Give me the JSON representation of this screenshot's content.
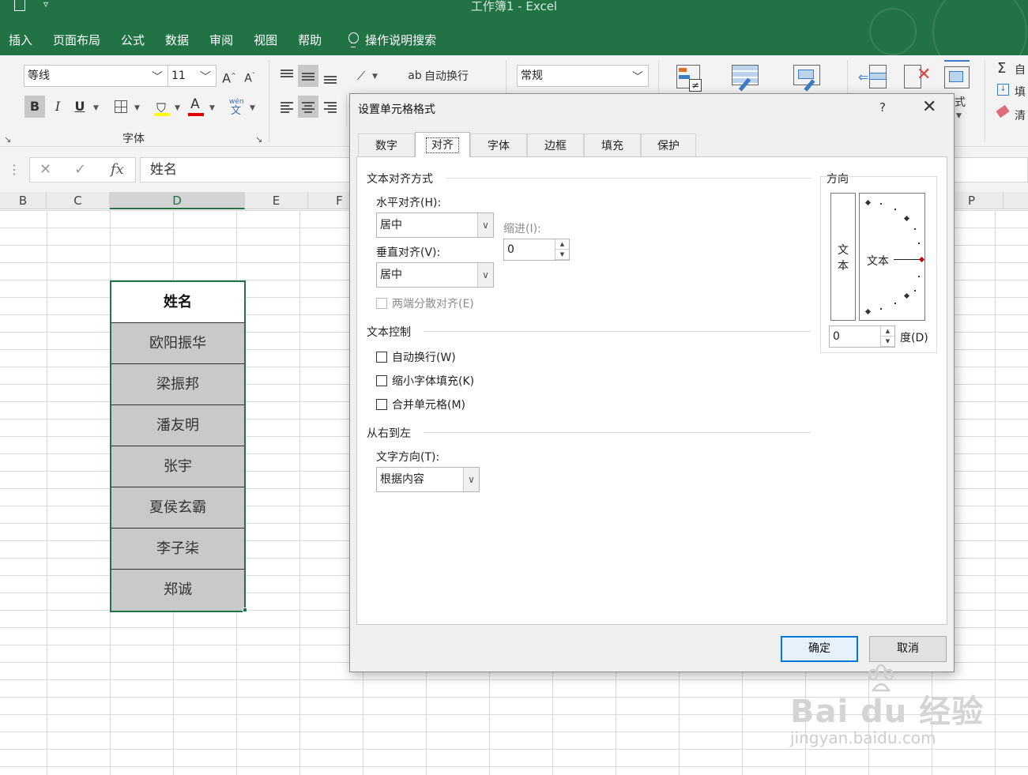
{
  "window": {
    "title": "工作簿1  -  Excel"
  },
  "menu": {
    "tabs": [
      "插入",
      "页面布局",
      "公式",
      "数据",
      "审阅",
      "视图",
      "帮助"
    ],
    "search": "操作说明搜索"
  },
  "ribbon": {
    "font_name": "等线",
    "font_size": "11",
    "grow_font": "A",
    "shrink_font": "A",
    "bold": "B",
    "italic": "I",
    "underline": "U",
    "font_color_glyph": "A",
    "phonetic_top": "wén",
    "phonetic_bottom": "文",
    "font_group_label": "字体",
    "wrap_text": "自动换行",
    "number_format": "常规",
    "format_label_partial": "式",
    "autosum_label": "自",
    "fill_label": "填",
    "clear_label": "清",
    "sigma_glyph": "Σ",
    "colors": {
      "highlight": "#ffff00",
      "font_color": "#e00000"
    }
  },
  "formula_bar": {
    "cancel_glyph": "✕",
    "enter_glyph": "✓",
    "fx_glyph": "fx",
    "value": "姓名"
  },
  "sheet": {
    "columns": [
      "B",
      "C",
      "D",
      "E",
      "F",
      "P"
    ],
    "selected_column": "D",
    "header": "姓名",
    "names": [
      "欧阳振华",
      "梁振邦",
      "潘友明",
      "张宇",
      "夏侯玄霸",
      "李子柒",
      "郑诚"
    ]
  },
  "dialog": {
    "title": "设置单元格格式",
    "help_glyph": "?",
    "close_glyph": "✕",
    "tabs": [
      "数字",
      "对齐",
      "字体",
      "边框",
      "填充",
      "保护"
    ],
    "active_tab": "对齐",
    "text_alignment": {
      "group_title": "文本对齐方式",
      "horizontal_label": "水平对齐(H):",
      "horizontal_value": "居中",
      "vertical_label": "垂直对齐(V):",
      "vertical_value": "居中",
      "indent_label": "缩进(I):",
      "indent_value": "0",
      "justify_distributed": "两端分散对齐(E)"
    },
    "text_control": {
      "group_title": "文本控制",
      "wrap_text": "自动换行(W)",
      "shrink_to_fit": "缩小字体填充(K)",
      "merge_cells": "合并单元格(M)"
    },
    "rtl": {
      "group_title": "从右到左",
      "direction_label": "文字方向(T):",
      "direction_value": "根据内容"
    },
    "orientation": {
      "group_title": "方向",
      "vertical_text_top": "文",
      "vertical_text_bottom": "本",
      "dial_text": "文本",
      "degrees_value": "0",
      "degrees_label": "度(D)"
    },
    "ok_label": "确定",
    "cancel_label": "取消"
  },
  "watermark": {
    "main": "Bai du 经验",
    "sub": "jingyan.baidu.com"
  }
}
